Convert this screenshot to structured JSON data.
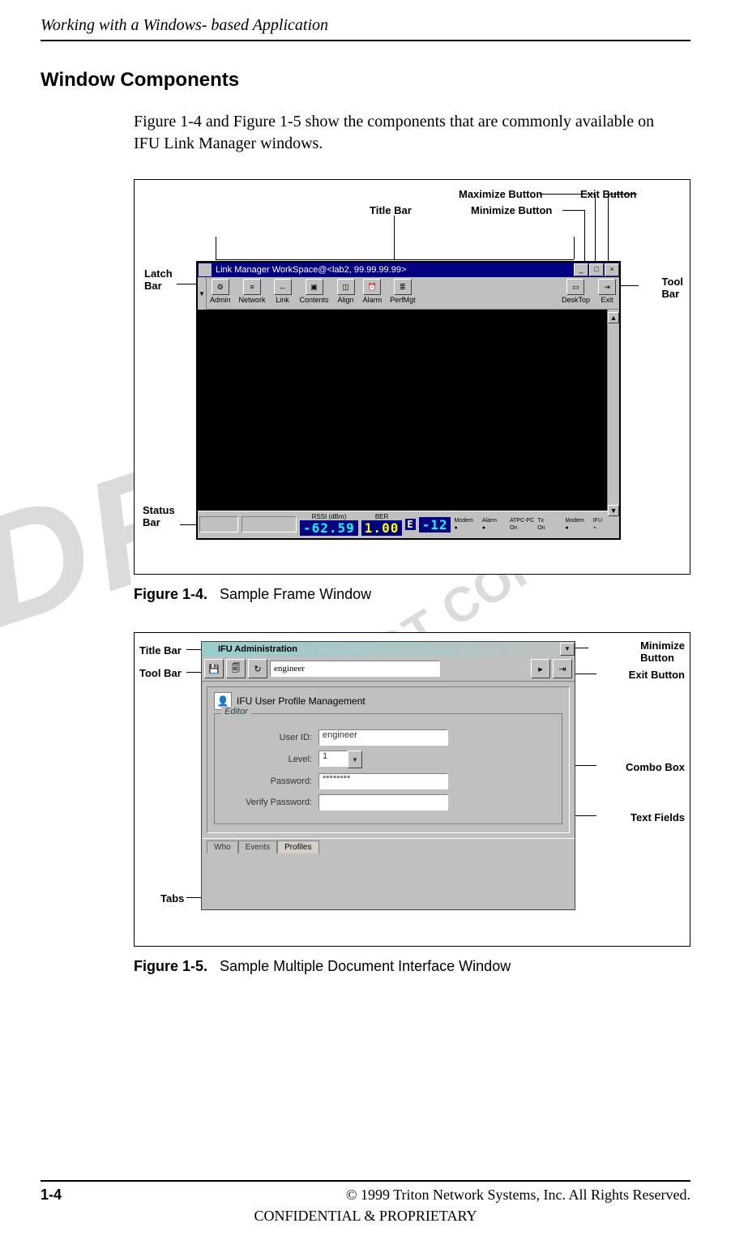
{
  "header": {
    "running_title": "Working with a Windows- based Application"
  },
  "section": {
    "title": "Window Components"
  },
  "intro": "Figure 1-4 and Figure 1-5 show the components that are commonly available on IFU Link Manager windows.",
  "watermarks": {
    "draft": "DRAFT",
    "copy": "DO NOT COPY"
  },
  "fig1": {
    "caption_strong": "Figure 1-4.",
    "caption_rest": "Sample Frame Window",
    "annotations": {
      "title_bar": "Title Bar",
      "minimize": "Minimize Button",
      "maximize": "Maximize Button",
      "exit": "Exit Button",
      "latch": "Latch\nBar",
      "tool": "Tool\nBar",
      "status": "Status\nBar"
    },
    "window": {
      "title": "Link Manager WorkSpace@<lab2, 99.99.99.99>",
      "toolbar": [
        {
          "label": "Admin"
        },
        {
          "label": "Network"
        },
        {
          "label": "Link"
        },
        {
          "label": "Contents"
        },
        {
          "label": "Align"
        },
        {
          "label": "Alarm"
        },
        {
          "label": "PerfMgt"
        }
      ],
      "toolbar_right": [
        {
          "label": "DeskTop"
        },
        {
          "label": "Exit"
        }
      ],
      "status": {
        "rssi_label": "RSSI (dBm)",
        "rssi_value": "-62.59",
        "ber_label": "BER",
        "ber_value": "1.00",
        "e_label": "E",
        "e_value": "-12",
        "items": [
          "Modem",
          "Alarm",
          "ATPC-PC",
          "Tx",
          "Modem",
          "IFU"
        ],
        "items2": [
          "",
          "",
          "On",
          "On",
          "",
          ""
        ]
      }
    }
  },
  "fig2": {
    "caption_strong": "Figure 1-5.",
    "caption_rest": "Sample Multiple Document Interface Window",
    "annotations": {
      "title_bar": "Title Bar",
      "tool_bar": "Tool Bar",
      "minimize": "Minimize\nButton",
      "exit": "Exit Button",
      "combo": "Combo Box",
      "textfields": "Text Fields",
      "tabs": "Tabs"
    },
    "window": {
      "title": "IFU Administration",
      "toolbar_user": "engineer",
      "panel_title": "IFU User Profile Management",
      "group": "Editor",
      "fields": {
        "user_id_label": "User ID:",
        "user_id_value": "engineer",
        "level_label": "Level:",
        "level_value": "1",
        "password_label": "Password:",
        "password_value": "********",
        "verify_label": "Verify Password:",
        "verify_value": ""
      },
      "tabs": [
        "Who",
        "Events",
        "Profiles"
      ]
    }
  },
  "footer": {
    "page": "1-4",
    "copyright": "© 1999 Triton Network Systems, Inc. All Rights Reserved.",
    "confidential": "CONFIDENTIAL & PROPRIETARY"
  }
}
